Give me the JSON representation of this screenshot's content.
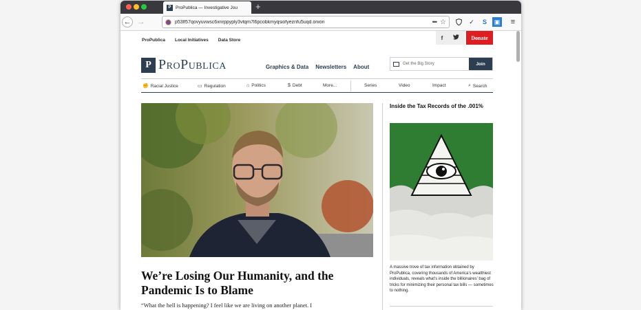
{
  "browser": {
    "tab_title": "ProPublica — Investigative Jou",
    "tab_favicon": "P",
    "url": "p53lf57qovyuvwsc6xnrppyply3vtqm7l6pcobkmyqsiofyeznfu5uqd.onion",
    "new_tab": "+",
    "icons": [
      "back-arrow-icon",
      "forward-arrow-icon",
      "onion-icon",
      "more-dots-icon",
      "star-icon",
      "shield-icon",
      "extension-icon",
      "s-icon",
      "container-icon",
      "menu-icon"
    ]
  },
  "site": {
    "top_links": [
      "ProPublica",
      "Local Initiatives",
      "Data Store"
    ],
    "social": {
      "facebook": "f",
      "twitter": "t"
    },
    "donate": "Donate",
    "logo_mark": "P",
    "logo_text": "ProPublica",
    "main_nav": [
      "Graphics & Data",
      "Newsletters",
      "About"
    ],
    "signup": {
      "placeholder": "Get the Big Story",
      "button": "Join"
    },
    "sub_nav_left": [
      {
        "label": "Racial Justice",
        "icon": "fist-icon"
      },
      {
        "label": "Regulation",
        "icon": "clipboard-icon"
      },
      {
        "label": "Politics",
        "icon": "capitol-icon"
      },
      {
        "label": "Debt",
        "icon": "dollar-icon"
      },
      {
        "label": "More...",
        "icon": ""
      }
    ],
    "sub_nav_right": [
      "Series",
      "Video",
      "Impact",
      "Search"
    ]
  },
  "feature": {
    "headline": "We’re Losing Our Humanity, and the Pandemic Is to Blame",
    "dek": "“What the hell is happening? I feel like we are living on another planet. I"
  },
  "sidebar": {
    "title": "Inside the Tax Records of the .001%",
    "blurb": "A massive trove of tax information obtained by ProPublica, covering thousands of America’s wealthiest individuals, reveals what’s inside the billionaires’ bag of tricks for minimizing their personal tax bills — sometimes to nothing."
  },
  "colors": {
    "brand_navy": "#2c3e50",
    "donate_red": "#dd1d20",
    "sidebar_green": "#2e7d32"
  }
}
